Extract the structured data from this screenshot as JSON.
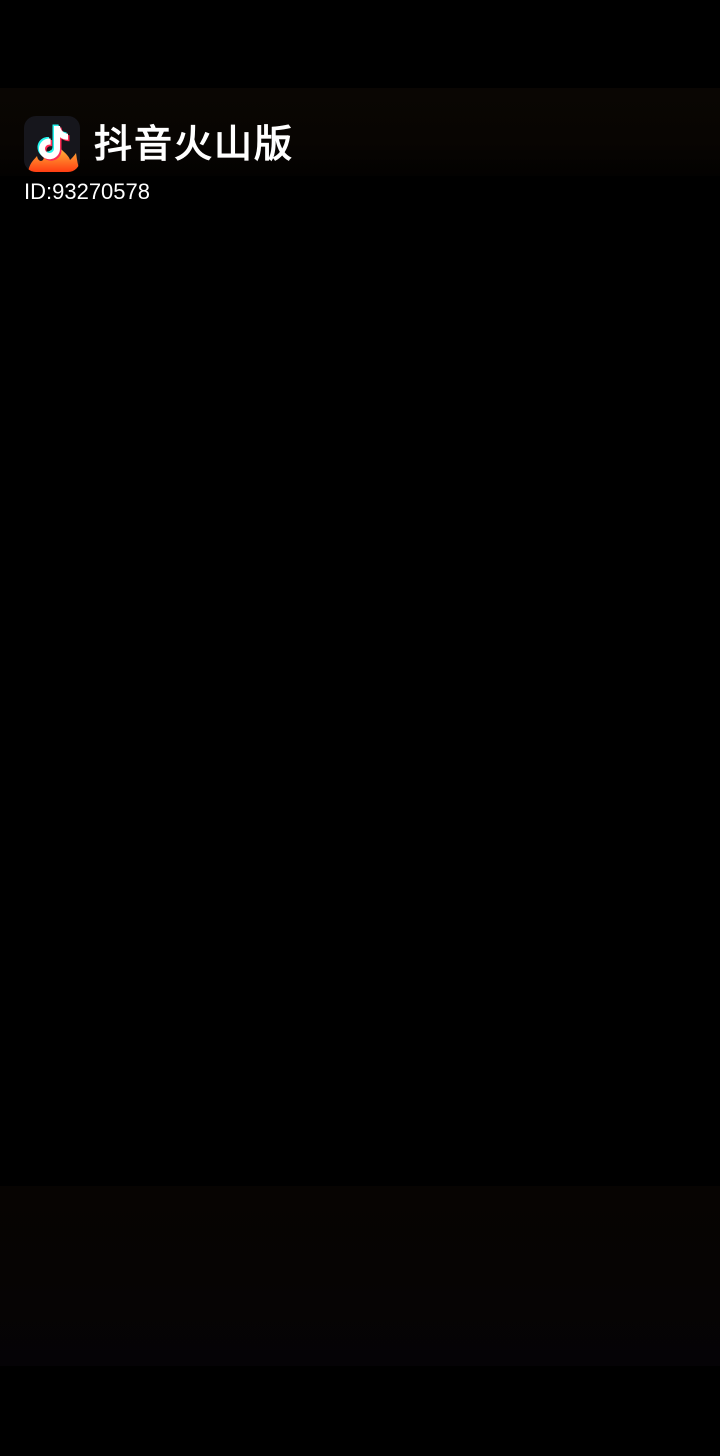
{
  "video_overlay": {
    "app_name": "抖音火山版",
    "user_id": "ID:93270578",
    "logo_icon": "douyin-huoshan-logo-icon"
  },
  "colors": {
    "background": "#000000",
    "text": "#ffffff",
    "logo_flame": "#ff5a1f"
  }
}
